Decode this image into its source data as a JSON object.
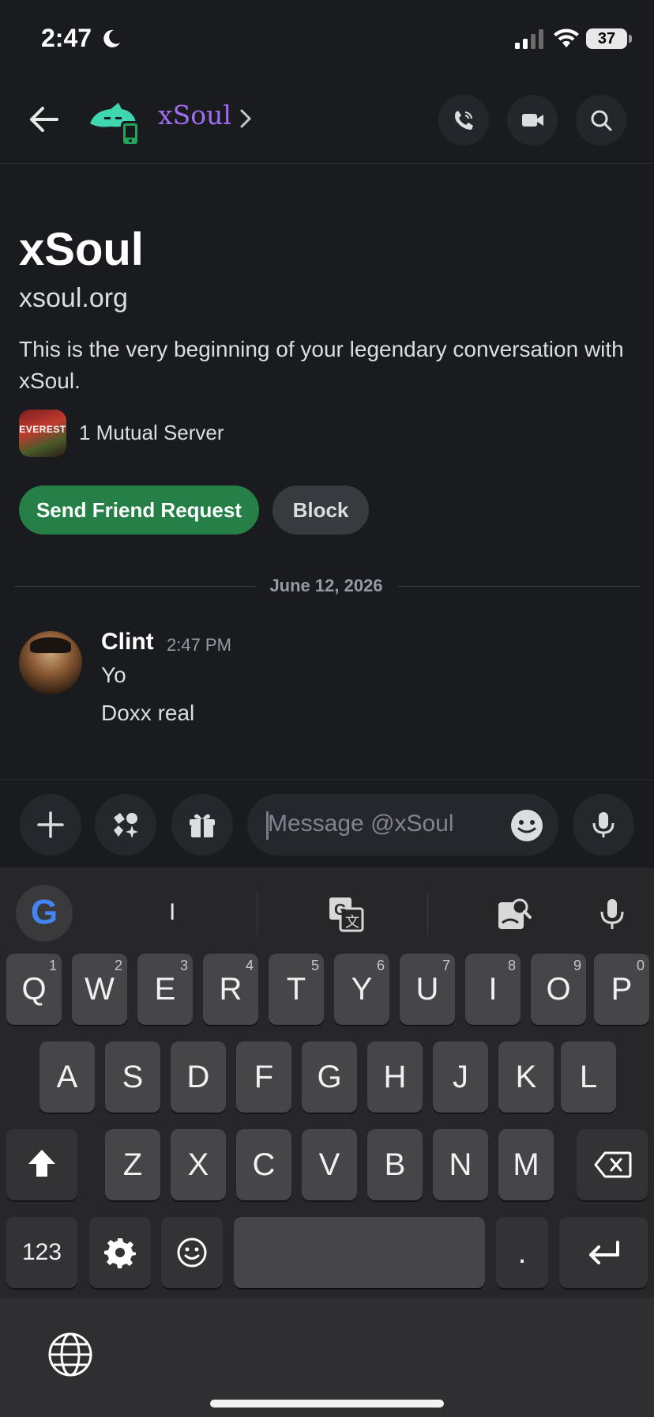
{
  "status_bar": {
    "time": "2:47",
    "battery": "37"
  },
  "header": {
    "title": "xSoul"
  },
  "profile": {
    "display_name": "xSoul",
    "subtitle": "xsoul.org",
    "intro_text": "This is the very beginning of your legendary conversation with xSoul.",
    "server_icon_text": "EVEREST",
    "mutual_servers": "1 Mutual Server",
    "send_friend_request_label": "Send Friend Request",
    "block_label": "Block"
  },
  "divider": {
    "date": "June 12, 2026"
  },
  "message": {
    "author": "Clint",
    "time": "2:47 PM",
    "lines": [
      "Yo",
      "Doxx real"
    ]
  },
  "composer": {
    "placeholder": "Message @xSoul"
  },
  "keyboard": {
    "google_logo": "G",
    "suggestion": "I",
    "row1": [
      {
        "key": "Q",
        "num": "1"
      },
      {
        "key": "W",
        "num": "2"
      },
      {
        "key": "E",
        "num": "3"
      },
      {
        "key": "R",
        "num": "4"
      },
      {
        "key": "T",
        "num": "5"
      },
      {
        "key": "Y",
        "num": "6"
      },
      {
        "key": "U",
        "num": "7"
      },
      {
        "key": "I",
        "num": "8"
      },
      {
        "key": "O",
        "num": "9"
      },
      {
        "key": "P",
        "num": "0"
      }
    ],
    "row2": [
      "A",
      "S",
      "D",
      "F",
      "G",
      "H",
      "J",
      "K",
      "L"
    ],
    "row3": [
      "Z",
      "X",
      "C",
      "V",
      "B",
      "N",
      "M"
    ],
    "numbers_label": "123",
    "period_label": "."
  },
  "colors": {
    "background": "#1a1b1f",
    "title_accent": "#a06cf0",
    "friend_button": "#248046",
    "block_button": "#383a40",
    "keyboard_bg": "#27272a",
    "key_bg": "#464649"
  },
  "icons": {
    "header": [
      "back-arrow-icon",
      "avatar-icon",
      "mobile-status-icon",
      "chevron-right-icon",
      "voice-call-icon",
      "video-call-icon",
      "search-icon"
    ],
    "composer": [
      "plus-icon",
      "apps-icon",
      "gift-icon",
      "emoji-icon",
      "microphone-icon"
    ],
    "keyboard": [
      "translate-icon",
      "lens-icon",
      "microphone-icon",
      "shift-icon",
      "backspace-icon",
      "settings-icon",
      "emoji-icon",
      "enter-icon",
      "globe-icon"
    ]
  }
}
